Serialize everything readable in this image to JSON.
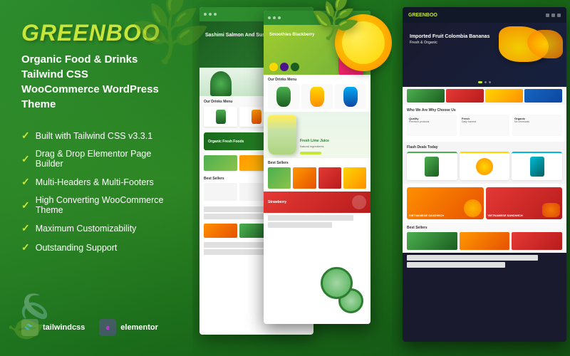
{
  "theme": {
    "brand_name": "GREENBOO",
    "tagline_line1": "Organic Food & Drinks Tailwind CSS",
    "tagline_line2": "WooCommerce WordPress Theme",
    "accent_green": "#c8e63a",
    "bg_green": "#2a7a2a"
  },
  "features": [
    "Built with Tailwind CSS v3.3.1",
    "Drag & Drop Elementor Page Builder",
    "Multi-Headers & Multi-Footers",
    "High Converting WooCommerce Theme",
    "Maximum Customizability",
    "Outstanding Support"
  ],
  "partner_logos": [
    {
      "name": "tailwindcss",
      "label": "tailwindcss"
    },
    {
      "name": "elementor",
      "label": "elementor"
    }
  ],
  "preview_left": {
    "hero_text": "Sashimi Salmon\nAnd Sushi",
    "section1_title": "Our Drinks Menu",
    "best_sellers_title": "Best Sellers",
    "banner_text": "Organic Fresh Foods"
  },
  "preview_middle": {
    "hero_text": "Smoothies\nBlackberry",
    "drinks_title": "Our Drinks Menu",
    "iced_title": "Fresh Lime Juice",
    "iced_desc": "Natural ingredients",
    "best_sellers_title": "Best Sellers"
  },
  "preview_right": {
    "header_logo": "GREENBOO",
    "hero_title": "Imported Fruit\nColombia Bananas",
    "hero_subtitle": "Fresh & Organic",
    "section_title": "Who We Are\nWhy Choose Us",
    "flash_deals_title": "Flash Deals Today",
    "best_sellers_title": "Best Sellers",
    "sandwich_label_1": "VIETNAMESE\nSANDWICH",
    "sandwich_label_2": "VIETNAMESE\nSANDWICH"
  }
}
